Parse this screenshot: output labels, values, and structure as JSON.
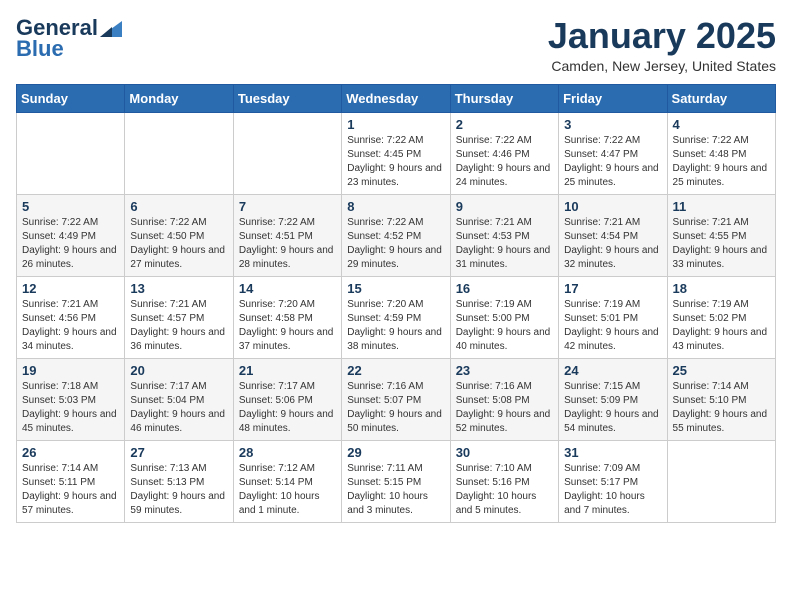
{
  "header": {
    "logo_line1": "General",
    "logo_line2": "Blue",
    "month": "January 2025",
    "location": "Camden, New Jersey, United States"
  },
  "weekdays": [
    "Sunday",
    "Monday",
    "Tuesday",
    "Wednesday",
    "Thursday",
    "Friday",
    "Saturday"
  ],
  "weeks": [
    [
      {
        "day": "",
        "sunrise": "",
        "sunset": "",
        "daylight": ""
      },
      {
        "day": "",
        "sunrise": "",
        "sunset": "",
        "daylight": ""
      },
      {
        "day": "",
        "sunrise": "",
        "sunset": "",
        "daylight": ""
      },
      {
        "day": "1",
        "sunrise": "Sunrise: 7:22 AM",
        "sunset": "Sunset: 4:45 PM",
        "daylight": "Daylight: 9 hours and 23 minutes."
      },
      {
        "day": "2",
        "sunrise": "Sunrise: 7:22 AM",
        "sunset": "Sunset: 4:46 PM",
        "daylight": "Daylight: 9 hours and 24 minutes."
      },
      {
        "day": "3",
        "sunrise": "Sunrise: 7:22 AM",
        "sunset": "Sunset: 4:47 PM",
        "daylight": "Daylight: 9 hours and 25 minutes."
      },
      {
        "day": "4",
        "sunrise": "Sunrise: 7:22 AM",
        "sunset": "Sunset: 4:48 PM",
        "daylight": "Daylight: 9 hours and 25 minutes."
      }
    ],
    [
      {
        "day": "5",
        "sunrise": "Sunrise: 7:22 AM",
        "sunset": "Sunset: 4:49 PM",
        "daylight": "Daylight: 9 hours and 26 minutes."
      },
      {
        "day": "6",
        "sunrise": "Sunrise: 7:22 AM",
        "sunset": "Sunset: 4:50 PM",
        "daylight": "Daylight: 9 hours and 27 minutes."
      },
      {
        "day": "7",
        "sunrise": "Sunrise: 7:22 AM",
        "sunset": "Sunset: 4:51 PM",
        "daylight": "Daylight: 9 hours and 28 minutes."
      },
      {
        "day": "8",
        "sunrise": "Sunrise: 7:22 AM",
        "sunset": "Sunset: 4:52 PM",
        "daylight": "Daylight: 9 hours and 29 minutes."
      },
      {
        "day": "9",
        "sunrise": "Sunrise: 7:21 AM",
        "sunset": "Sunset: 4:53 PM",
        "daylight": "Daylight: 9 hours and 31 minutes."
      },
      {
        "day": "10",
        "sunrise": "Sunrise: 7:21 AM",
        "sunset": "Sunset: 4:54 PM",
        "daylight": "Daylight: 9 hours and 32 minutes."
      },
      {
        "day": "11",
        "sunrise": "Sunrise: 7:21 AM",
        "sunset": "Sunset: 4:55 PM",
        "daylight": "Daylight: 9 hours and 33 minutes."
      }
    ],
    [
      {
        "day": "12",
        "sunrise": "Sunrise: 7:21 AM",
        "sunset": "Sunset: 4:56 PM",
        "daylight": "Daylight: 9 hours and 34 minutes."
      },
      {
        "day": "13",
        "sunrise": "Sunrise: 7:21 AM",
        "sunset": "Sunset: 4:57 PM",
        "daylight": "Daylight: 9 hours and 36 minutes."
      },
      {
        "day": "14",
        "sunrise": "Sunrise: 7:20 AM",
        "sunset": "Sunset: 4:58 PM",
        "daylight": "Daylight: 9 hours and 37 minutes."
      },
      {
        "day": "15",
        "sunrise": "Sunrise: 7:20 AM",
        "sunset": "Sunset: 4:59 PM",
        "daylight": "Daylight: 9 hours and 38 minutes."
      },
      {
        "day": "16",
        "sunrise": "Sunrise: 7:19 AM",
        "sunset": "Sunset: 5:00 PM",
        "daylight": "Daylight: 9 hours and 40 minutes."
      },
      {
        "day": "17",
        "sunrise": "Sunrise: 7:19 AM",
        "sunset": "Sunset: 5:01 PM",
        "daylight": "Daylight: 9 hours and 42 minutes."
      },
      {
        "day": "18",
        "sunrise": "Sunrise: 7:19 AM",
        "sunset": "Sunset: 5:02 PM",
        "daylight": "Daylight: 9 hours and 43 minutes."
      }
    ],
    [
      {
        "day": "19",
        "sunrise": "Sunrise: 7:18 AM",
        "sunset": "Sunset: 5:03 PM",
        "daylight": "Daylight: 9 hours and 45 minutes."
      },
      {
        "day": "20",
        "sunrise": "Sunrise: 7:17 AM",
        "sunset": "Sunset: 5:04 PM",
        "daylight": "Daylight: 9 hours and 46 minutes."
      },
      {
        "day": "21",
        "sunrise": "Sunrise: 7:17 AM",
        "sunset": "Sunset: 5:06 PM",
        "daylight": "Daylight: 9 hours and 48 minutes."
      },
      {
        "day": "22",
        "sunrise": "Sunrise: 7:16 AM",
        "sunset": "Sunset: 5:07 PM",
        "daylight": "Daylight: 9 hours and 50 minutes."
      },
      {
        "day": "23",
        "sunrise": "Sunrise: 7:16 AM",
        "sunset": "Sunset: 5:08 PM",
        "daylight": "Daylight: 9 hours and 52 minutes."
      },
      {
        "day": "24",
        "sunrise": "Sunrise: 7:15 AM",
        "sunset": "Sunset: 5:09 PM",
        "daylight": "Daylight: 9 hours and 54 minutes."
      },
      {
        "day": "25",
        "sunrise": "Sunrise: 7:14 AM",
        "sunset": "Sunset: 5:10 PM",
        "daylight": "Daylight: 9 hours and 55 minutes."
      }
    ],
    [
      {
        "day": "26",
        "sunrise": "Sunrise: 7:14 AM",
        "sunset": "Sunset: 5:11 PM",
        "daylight": "Daylight: 9 hours and 57 minutes."
      },
      {
        "day": "27",
        "sunrise": "Sunrise: 7:13 AM",
        "sunset": "Sunset: 5:13 PM",
        "daylight": "Daylight: 9 hours and 59 minutes."
      },
      {
        "day": "28",
        "sunrise": "Sunrise: 7:12 AM",
        "sunset": "Sunset: 5:14 PM",
        "daylight": "Daylight: 10 hours and 1 minute."
      },
      {
        "day": "29",
        "sunrise": "Sunrise: 7:11 AM",
        "sunset": "Sunset: 5:15 PM",
        "daylight": "Daylight: 10 hours and 3 minutes."
      },
      {
        "day": "30",
        "sunrise": "Sunrise: 7:10 AM",
        "sunset": "Sunset: 5:16 PM",
        "daylight": "Daylight: 10 hours and 5 minutes."
      },
      {
        "day": "31",
        "sunrise": "Sunrise: 7:09 AM",
        "sunset": "Sunset: 5:17 PM",
        "daylight": "Daylight: 10 hours and 7 minutes."
      },
      {
        "day": "",
        "sunrise": "",
        "sunset": "",
        "daylight": ""
      }
    ]
  ]
}
